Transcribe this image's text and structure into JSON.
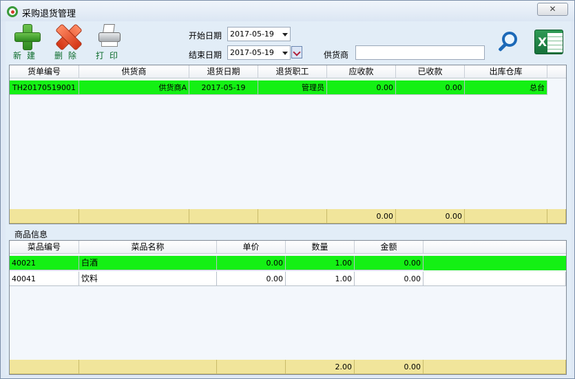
{
  "window": {
    "title": "采购退货管理",
    "close_label": "✕"
  },
  "toolbar": {
    "new_label": "新建",
    "delete_label": "删除",
    "print_label": "打印",
    "start_date_label": "开始日期",
    "end_date_label": "结束日期",
    "start_date": "2017-05-19",
    "end_date": "2017-05-19",
    "supplier_label": "供货商",
    "supplier_value": ""
  },
  "returns_table": {
    "headers": [
      "货单编号",
      "供货商",
      "退货日期",
      "退货职工",
      "应收款",
      "已收款",
      "出库仓库"
    ],
    "rows": [
      [
        "TH20170519001",
        "供货商A",
        "2017-05-19",
        "管理员",
        "0.00",
        "0.00",
        "总台"
      ]
    ],
    "totals": [
      "",
      "",
      "",
      "",
      "0.00",
      "0.00",
      ""
    ]
  },
  "items_section": {
    "title": "商品信息"
  },
  "items_table": {
    "headers": [
      "菜品编号",
      "菜品名称",
      "单价",
      "数量",
      "金额"
    ],
    "rows": [
      [
        "40021",
        "白酒",
        "0.00",
        "1.00",
        "0.00"
      ],
      [
        "40041",
        "饮料",
        "0.00",
        "1.00",
        "0.00"
      ]
    ],
    "totals": [
      "",
      "",
      "",
      "2.00",
      "0.00"
    ]
  },
  "colors": {
    "selected_row": "#14f014",
    "footer_row": "#f1e59b",
    "window_bg": "#e2edf7"
  },
  "icons": [
    "app-icon",
    "add-icon",
    "delete-icon",
    "printer-icon",
    "search-icon",
    "excel-icon",
    "dropdown-arrow-icon",
    "calendar-icon"
  ]
}
